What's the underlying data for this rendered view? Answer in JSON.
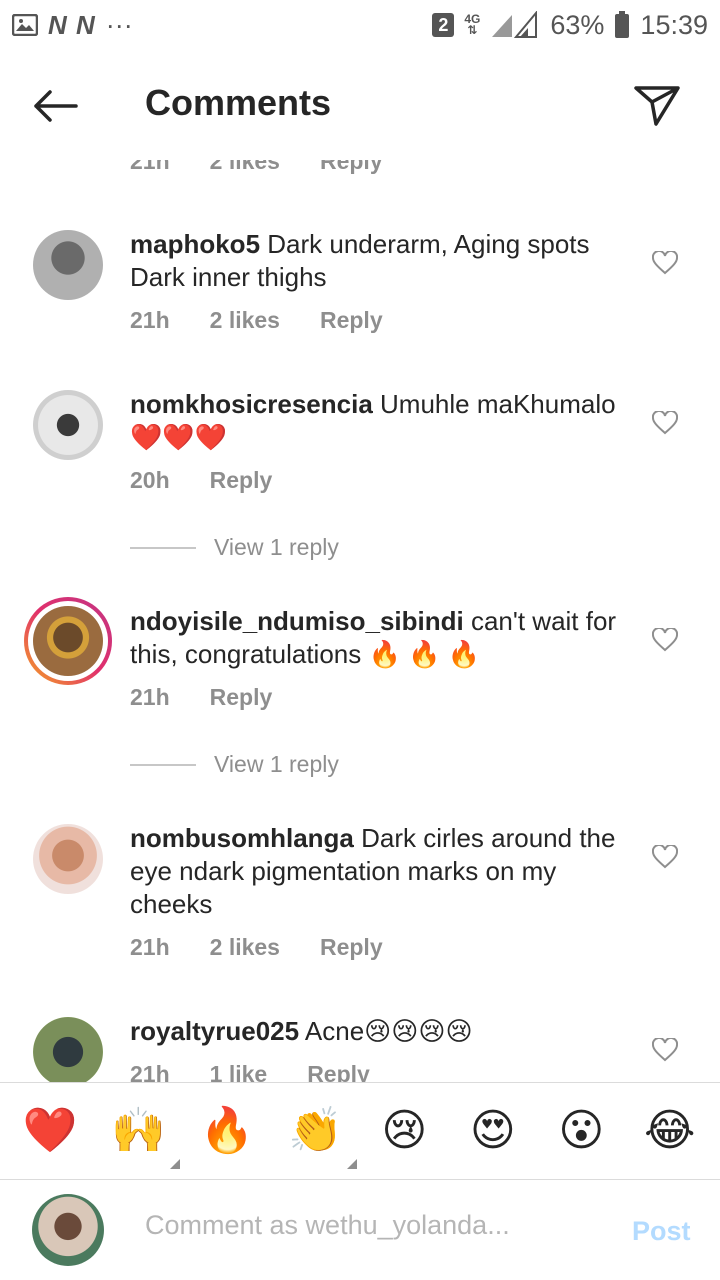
{
  "status_bar": {
    "left_icons": [
      "image-icon",
      "nn-icon",
      "more-dots-icon"
    ],
    "nn_text": "N N",
    "dots": "···",
    "sim_badge": "2",
    "network": "4G",
    "battery_percent": "63%",
    "time": "15:39"
  },
  "header": {
    "title": "Comments",
    "back_icon": "arrow-left-icon",
    "send_icon": "paper-plane-icon"
  },
  "partial_top": {
    "time": "21h",
    "likes": "2 likes",
    "reply": "Reply"
  },
  "comments": [
    {
      "username": "maphoko5",
      "text": " Dark underarm, Aging spots Dark inner  thighs",
      "time": "21h",
      "likes": "2 likes",
      "reply": "Reply"
    },
    {
      "username": "nomkhosicresencia",
      "text": " Umuhle maKhumalo❤️❤️❤️",
      "time": "20h",
      "reply": "Reply",
      "view_replies": "View 1 reply"
    },
    {
      "username": "ndoyisile_ndumiso_sibindi",
      "text": " can't wait for this, congratulations 🔥 🔥 🔥",
      "time": "21h",
      "reply": "Reply",
      "view_replies": "View 1 reply"
    },
    {
      "username": "nombusomhlanga",
      "text": " Dark cirles around the eye ndark pigmentation marks on my cheeks",
      "time": "21h",
      "likes": "2 likes",
      "reply": "Reply"
    },
    {
      "username": "royaltyrue025",
      "text": " Acne😢😢😢😢",
      "time": "21h",
      "likes": "1 like",
      "reply": "Reply"
    }
  ],
  "emoji_bar": [
    "❤️",
    "🙌",
    "🔥",
    "👏",
    "😢",
    "😍",
    "😮",
    "😂"
  ],
  "comment_input": {
    "placeholder": "Comment as wethu_yolanda...",
    "post_label": "Post"
  },
  "colors": {
    "text": "#262626",
    "meta": "#8e8e8e",
    "post_disabled": "#b3dbff",
    "story_ring_start": "#f5a623",
    "story_ring_end": "#c13584"
  }
}
